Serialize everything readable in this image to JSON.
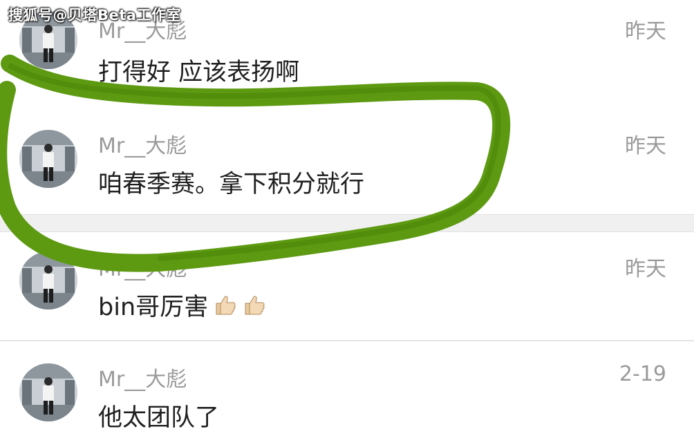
{
  "watermark": "搜狐号@贝塔Beta工作室",
  "comments": [
    {
      "username": "Mr__大彪",
      "time": "昨天",
      "text": "打得好 应该表扬啊",
      "emoji_count": 0
    },
    {
      "username": "Mr__大彪",
      "time": "昨天",
      "text": "咱春季赛。拿下积分就行",
      "emoji_count": 0
    },
    {
      "username": "Mr__大彪",
      "time": "昨天",
      "text": "bin哥厉害",
      "emoji": [
        "thumbs-up-icon",
        "thumbs-up-icon"
      ]
    },
    {
      "username": "Mr__大彪",
      "time": "2-19",
      "text": "他太团队了",
      "emoji_count": 0
    }
  ],
  "colors": {
    "highlight_stroke": "#5d9a12",
    "meta_text": "#9a9a9a",
    "body_text": "#1f1f1f"
  }
}
